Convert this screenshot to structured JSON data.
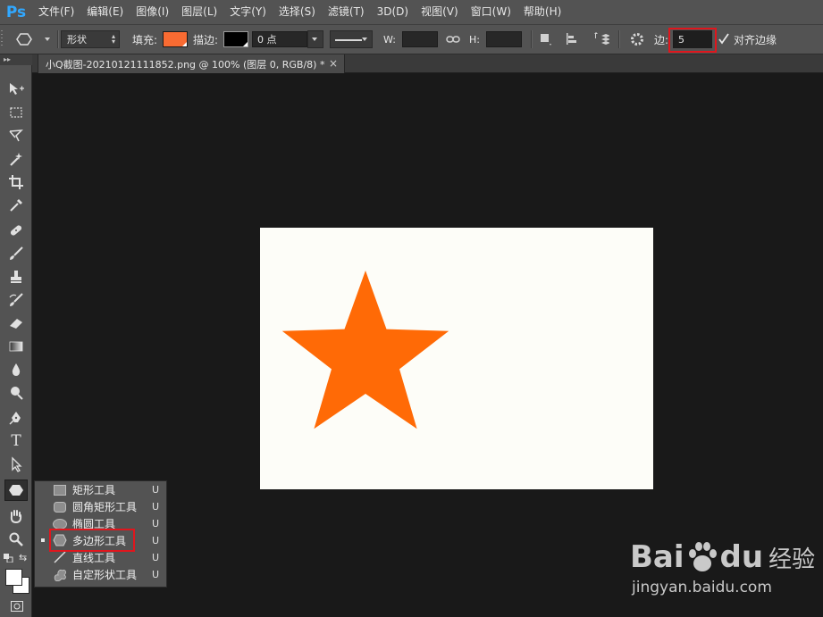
{
  "app": {
    "logo": "Ps"
  },
  "menu": [
    "文件(F)",
    "编辑(E)",
    "图像(I)",
    "图层(L)",
    "文字(Y)",
    "选择(S)",
    "滤镜(T)",
    "3D(D)",
    "视图(V)",
    "窗口(W)",
    "帮助(H)"
  ],
  "options": {
    "mode_value": "形状",
    "fill_label": "填充:",
    "fill_color": "#f96b32",
    "stroke_label": "描边:",
    "stroke_color": "#000000",
    "stroke_width": "0 点",
    "w_label": "W:",
    "h_label": "H:",
    "sides_label": "边:",
    "sides_value": "5",
    "align_edges_label": "对齐边缘",
    "align_edges_checked": true
  },
  "document": {
    "tab_title": "小Q截图-20210121111852.png @ 100% (图层 0, RGB/8) *",
    "close_glyph": "×",
    "canvas_bg": "#fdfdf8",
    "star_color": "#ff6a06",
    "star_points": 5
  },
  "flyout": {
    "items": [
      {
        "label": "矩形工具",
        "key": "U",
        "icon": "rectangle-icon"
      },
      {
        "label": "圆角矩形工具",
        "key": "U",
        "icon": "rounded-rectangle-icon"
      },
      {
        "label": "椭圆工具",
        "key": "U",
        "icon": "ellipse-icon"
      },
      {
        "label": "多边形工具",
        "key": "U",
        "icon": "polygon-icon",
        "selected": true
      },
      {
        "label": "直线工具",
        "key": "U",
        "icon": "line-icon"
      },
      {
        "label": "自定形状工具",
        "key": "U",
        "icon": "custom-shape-icon"
      }
    ]
  },
  "toolbar": {
    "tools": [
      "move-icon",
      "marquee-icon",
      "lasso-icon",
      "magic-wand-icon",
      "crop-icon",
      "eyedropper-icon",
      "healing-brush-icon",
      "brush-icon",
      "clone-stamp-icon",
      "history-brush-icon",
      "eraser-icon",
      "gradient-icon",
      "blur-icon",
      "dodge-icon",
      "pen-icon",
      "type-icon",
      "path-selection-icon",
      "polygon-icon",
      "hand-icon",
      "zoom-icon"
    ],
    "active_tool": "polygon-icon",
    "type_glyph": "T"
  },
  "watermark": {
    "logo_left": "Bai",
    "logo_right": "du",
    "cn": "经验",
    "url": "jingyan.baidu.com"
  }
}
